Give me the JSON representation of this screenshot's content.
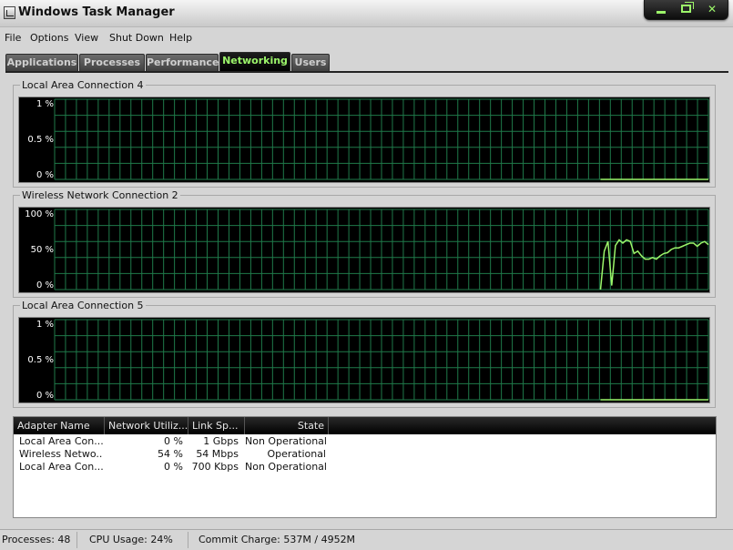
{
  "window": {
    "title": "Windows Task Manager",
    "accent_color": "#9cf56a"
  },
  "menu": {
    "items": [
      "File",
      "Options",
      "View",
      "Shut Down",
      "Help"
    ]
  },
  "tabs": {
    "items": [
      "Applications",
      "Processes",
      "Performance",
      "Networking",
      "Users"
    ],
    "active": "Networking"
  },
  "graphs": [
    {
      "label": "Local Area Connection 4",
      "y_labels": [
        "1 %",
        "0.5 %",
        "0 %"
      ],
      "y_max": 1,
      "series_values": [
        0,
        0,
        0,
        0,
        0,
        0,
        0,
        0,
        0,
        0,
        0,
        0,
        0,
        0,
        0,
        0,
        0,
        0,
        0,
        0,
        0,
        0,
        0,
        0,
        0,
        0,
        0
      ]
    },
    {
      "label": "Wireless Network Connection 2",
      "y_labels": [
        "100 %",
        "50 %",
        "0 %"
      ],
      "y_max": 100,
      "series_values": [
        0,
        48,
        60,
        5,
        55,
        62,
        58,
        62,
        60,
        45,
        48,
        42,
        38,
        38,
        40,
        38,
        42,
        45,
        46,
        50,
        52,
        52,
        54,
        56,
        58,
        58,
        54,
        58,
        60,
        56
      ]
    },
    {
      "label": "Local Area Connection 5",
      "y_labels": [
        "1 %",
        "0.5 %",
        "0 %"
      ],
      "y_max": 1,
      "series_values": [
        0,
        0,
        0,
        0,
        0,
        0,
        0,
        0,
        0,
        0,
        0,
        0,
        0,
        0,
        0,
        0,
        0,
        0,
        0,
        0,
        0,
        0,
        0,
        0,
        0,
        0,
        0
      ]
    }
  ],
  "table": {
    "columns": [
      "Adapter Name",
      "Network Utiliz...",
      "Link Sp...",
      "State"
    ],
    "rows": [
      [
        "Local Area Con...",
        "0 %",
        "1 Gbps",
        "Non Operational"
      ],
      [
        "Wireless Netwo...",
        "54 %",
        "54 Mbps",
        "Operational"
      ],
      [
        "Local Area Con...",
        "0 %",
        "700 Kbps",
        "Non Operational"
      ]
    ]
  },
  "status": {
    "processes": "Processes: 48",
    "cpu": "CPU Usage: 24%",
    "commit": "Commit Charge: 537M / 4952M"
  }
}
